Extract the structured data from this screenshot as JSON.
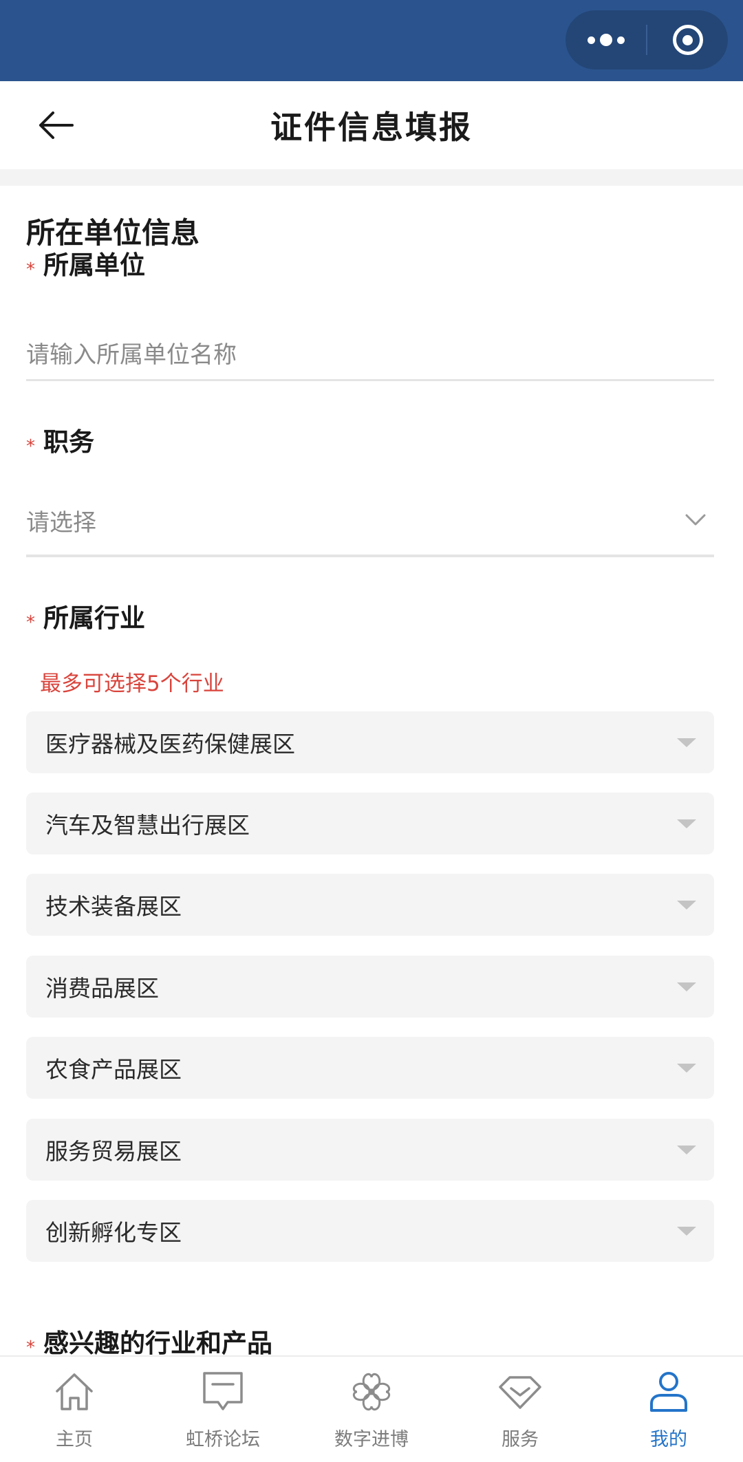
{
  "page": {
    "title": "证件信息填报"
  },
  "section": {
    "title": "所在单位信息"
  },
  "fields": {
    "company": {
      "required_mark": "*",
      "label": "所属单位",
      "placeholder": "请输入所属单位名称",
      "value": ""
    },
    "position": {
      "required_mark": "*",
      "label": "职务",
      "placeholder": "请选择"
    },
    "industry": {
      "required_mark": "*",
      "label": "所属行业",
      "hint": "最多可选择5个行业",
      "options": [
        {
          "label": "医疗器械及医药保健展区"
        },
        {
          "label": "汽车及智慧出行展区"
        },
        {
          "label": "技术装备展区"
        },
        {
          "label": "消费品展区"
        },
        {
          "label": "农食产品展区"
        },
        {
          "label": "服务贸易展区"
        },
        {
          "label": "创新孵化专区"
        }
      ]
    },
    "interest": {
      "required_mark": "*",
      "label": "感兴趣的行业和产品"
    }
  },
  "tabbar": {
    "items": [
      {
        "label": "主页",
        "icon": "home-icon"
      },
      {
        "label": "虹桥论坛",
        "icon": "forum-icon"
      },
      {
        "label": "数字进博",
        "icon": "clover-icon"
      },
      {
        "label": "服务",
        "icon": "diamond-icon"
      },
      {
        "label": "我的",
        "icon": "user-icon"
      }
    ],
    "active_index": 4
  },
  "colors": {
    "header_bg": "#2b548e",
    "required": "#d9443c",
    "active_tab": "#2474c9",
    "option_bg": "#f4f4f4"
  }
}
